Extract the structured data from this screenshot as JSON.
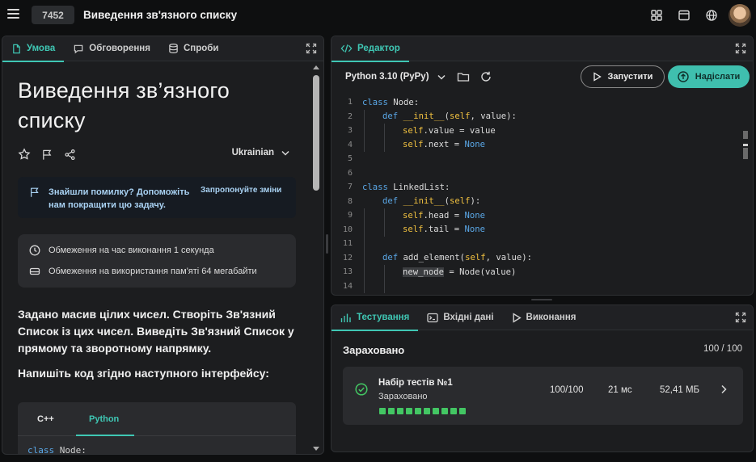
{
  "topbar": {
    "task_id": "7452",
    "task_title": "Виведення зв'язного списку",
    "icons": [
      "grid-icon",
      "window-icon",
      "globe-icon",
      "user-avatar"
    ]
  },
  "left_panel": {
    "tabs": [
      {
        "label": "Умова",
        "icon": "doc-icon",
        "active": true
      },
      {
        "label": "Обговорення",
        "icon": "chat-icon",
        "active": false
      },
      {
        "label": "Спроби",
        "icon": "database-icon",
        "active": false
      }
    ],
    "title": "Виведення зв’язного списку",
    "language": "Ukrainian",
    "notice": {
      "message": "Знайшли помилку? Допоможіть нам покращити цю задачу.",
      "link": "Запропонуйте зміни"
    },
    "limits": {
      "time": "Обмеження на час виконання 1 секунда",
      "memory": "Обмеження на використання пам'яті 64 мегабайти"
    },
    "description": "Задано масив цілих чисел. Створіть Зв'язний Список із цих чисел. Виведіть Зв'язний Список у прямому та зворотному напрямку.",
    "interface_intro": "Напишіть код згідно наступного інтерфейсу:",
    "code_tabs": [
      "C++",
      "Python"
    ],
    "code_active_tab": "Python",
    "code_preview": {
      "kw": "class",
      "name": "Node:"
    }
  },
  "editor": {
    "tab_label": "Редактор",
    "language": "Python 3.10 (PyPy)",
    "run_label": "Запустити",
    "submit_label": "Надіслати",
    "lines": [
      {
        "n": "1",
        "indent": 0,
        "html": "<span class=\"kw\">class</span> Node:"
      },
      {
        "n": "2",
        "indent": 1,
        "html": "<span class=\"kw\">def</span> <span class=\"attr\">__init__</span>(<span class=\"self\">self</span>, value):"
      },
      {
        "n": "3",
        "indent": 2,
        "html": "<span class=\"self\">self</span>.value = value"
      },
      {
        "n": "4",
        "indent": 2,
        "html": "<span class=\"self\">self</span>.next = <span class=\"none\">None</span>"
      },
      {
        "n": "5",
        "indent": 0,
        "html": ""
      },
      {
        "n": "6",
        "indent": 0,
        "html": ""
      },
      {
        "n": "7",
        "indent": 0,
        "html": "<span class=\"kw\">class</span> LinkedList:"
      },
      {
        "n": "8",
        "indent": 1,
        "html": "<span class=\"kw\">def</span> <span class=\"attr\">__init__</span>(<span class=\"self\">self</span>):"
      },
      {
        "n": "9",
        "indent": 2,
        "html": "<span class=\"self\">self</span>.head = <span class=\"none\">None</span>"
      },
      {
        "n": "10",
        "indent": 2,
        "html": "<span class=\"self\">self</span>.tail = <span class=\"none\">None</span>"
      },
      {
        "n": "11",
        "indent": 0,
        "html": ""
      },
      {
        "n": "12",
        "indent": 1,
        "html": "<span class=\"kw\">def</span> add_element(<span class=\"self\">self</span>, value):"
      },
      {
        "n": "13",
        "indent": 2,
        "html": "<span class=\"hl\">new_node</span> = Node(value)"
      },
      {
        "n": "14",
        "indent": 0,
        "html": ""
      }
    ]
  },
  "test_panel": {
    "tabs": [
      {
        "label": "Тестування",
        "icon": "chart-icon",
        "active": true
      },
      {
        "label": "Вхідні дані",
        "icon": "terminal-icon",
        "active": false
      },
      {
        "label": "Виконання",
        "icon": "play-icon",
        "active": false
      }
    ],
    "status": "Зараховано",
    "score": "100 / 100",
    "suite": {
      "name": "Набір тестів №1",
      "status": "Зараховано",
      "points": "100/100",
      "time": "21 мс",
      "memory": "52,41 МБ",
      "tests_passed": 10
    }
  }
}
